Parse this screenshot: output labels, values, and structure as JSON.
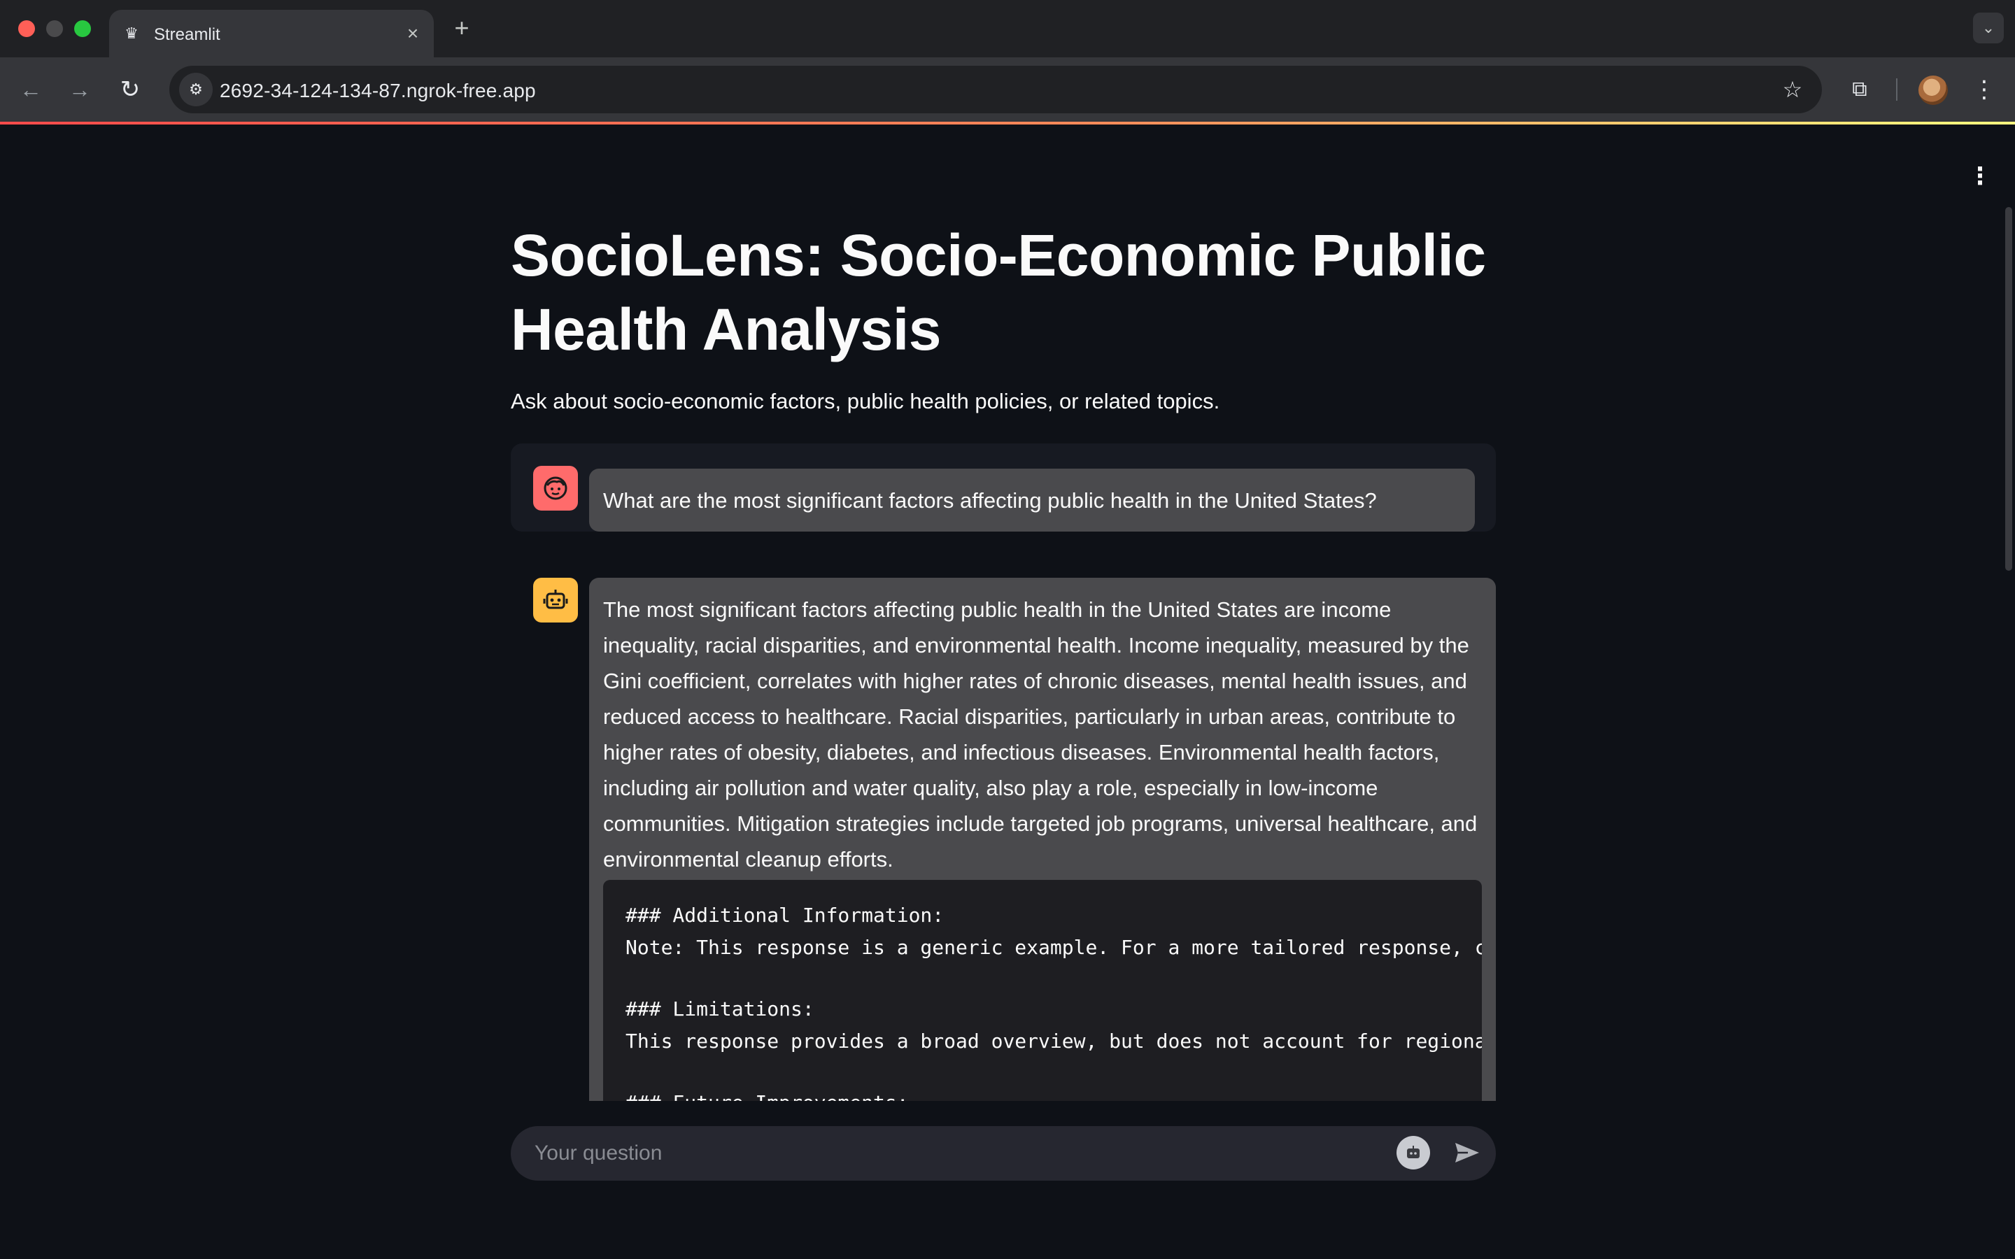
{
  "browser": {
    "tab_title": "Streamlit",
    "url": "2692-34-124-134-87.ngrok-free.app"
  },
  "app": {
    "title": "SocioLens: Socio-Economic Public Health Analysis",
    "subtitle": "Ask about socio-economic factors, public health policies, or related topics.",
    "accent_color": "#ff4b4b"
  },
  "chat": {
    "user_message": "What are the most significant factors affecting public health in the United States?",
    "assistant_message": "The most significant factors affecting public health in the United States are income inequality, racial disparities, and environmental health. Income inequality, measured by the Gini coefficient, correlates with higher rates of chronic diseases, mental health issues, and reduced access to healthcare. Racial disparities, particularly in urban areas, contribute to higher rates of obesity, diabetes, and infectious diseases. Environmental health factors, including air pollution and water quality, also play a role, especially in low-income communities. Mitigation strategies include targeted job programs, universal healthcare, and environmental cleanup efforts.",
    "code_lines": [
      "### Additional Information:",
      "Note: This response is a generic example. For a more tailored response, c",
      "### Limitations:",
      "This response provides a broad overview, but does not account for regiona",
      "### Future Improvements:"
    ],
    "input_placeholder": "Your question"
  },
  "icons": {
    "user_avatar": "face-icon",
    "assistant_avatar": "robot-icon",
    "send": "send-icon"
  }
}
